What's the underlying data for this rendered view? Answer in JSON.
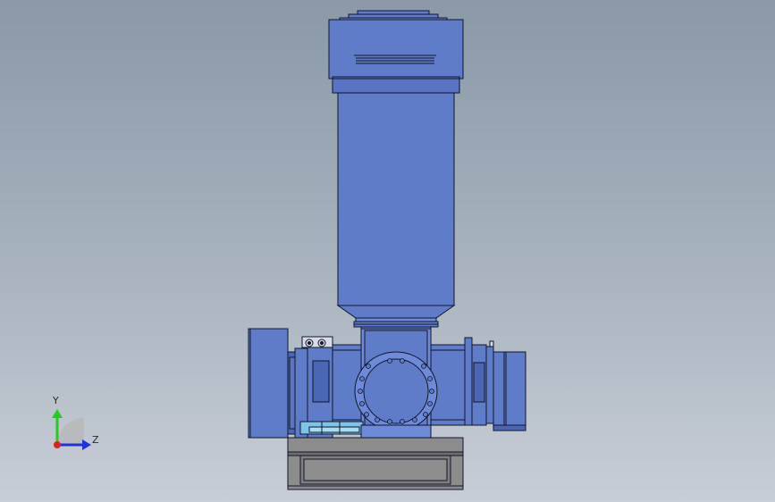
{
  "triad": {
    "y_label": "Y",
    "z_label": "Z",
    "y_color": "#22cc22",
    "z_color": "#2233dd",
    "x_color": "#dd2222"
  },
  "colors": {
    "body_blue": "#5f7cc8",
    "body_blue_dark": "#4a66b4",
    "flange_blue": "#6d8bd8",
    "base_gray": "#8c8c8c",
    "base_gray_dark": "#6e6e6e",
    "cyan_part": "#7ec4e6",
    "edge": "#10152a"
  }
}
